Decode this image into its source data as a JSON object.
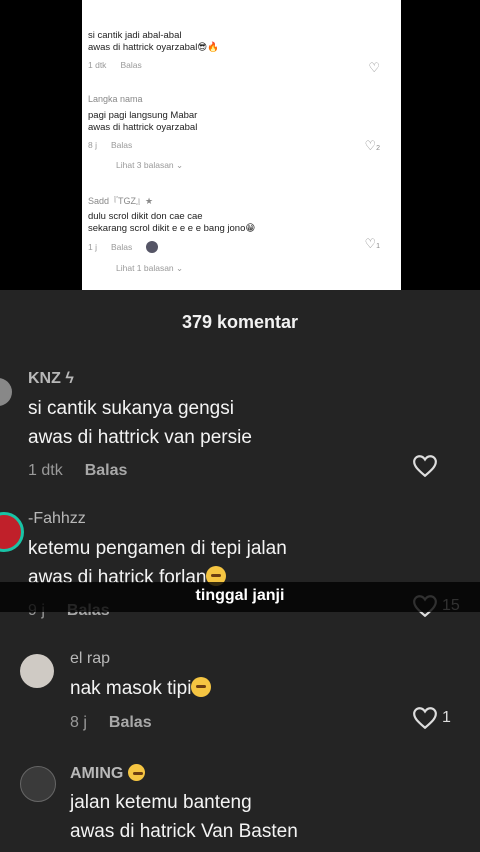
{
  "inset": {
    "comments": [
      {
        "text1": "si cantik jadi abal-abal",
        "text2": "awas di hattrick oyarzabal😎🔥",
        "time": "1 dtk",
        "reply": "Balas",
        "likes": ""
      },
      {
        "name": "Langka nama",
        "text1": "pagi pagi langsung Mabar",
        "text2": "awas di hattrick oyarzabal",
        "time": "8 j",
        "reply": "Balas",
        "likes": "2",
        "more": "Lihat 3 balasan ⌄"
      },
      {
        "name": "Sadd『TGZ』★",
        "text1": "dulu scrol dikit don cae cae",
        "text2": "sekarang scrol dikit e e e e bang jono😁",
        "time": "1 j",
        "reply": "Balas",
        "likes": "1",
        "more": "Lihat 1 balasan ⌄"
      }
    ]
  },
  "header": {
    "count": "379 komentar"
  },
  "comments": [
    {
      "user": "KNZ ϟ",
      "line1": "si cantik sukanya gengsi",
      "line2": "awas di hattrick van persie",
      "time": "1 dtk",
      "reply": "Balas",
      "likes": ""
    },
    {
      "user": "-Fahhzz",
      "line1": "ketemu pengamen di tepi jalan",
      "line2": "awas di hatrick forlan",
      "time": "9 j",
      "reply": "Balas",
      "likes": "15"
    },
    {
      "user": "el rap",
      "line1": "nak masok tipi",
      "time": "8 j",
      "reply": "Balas",
      "likes": "1"
    },
    {
      "user": "AMING",
      "line1": "jalan ketemu banteng",
      "line2": "awas di hatrick Van Basten"
    }
  ],
  "caption": "tinggal janji",
  "colors": {
    "panel": "#242424",
    "caption_bg": "#000000",
    "accent_ring": "#19c3a6"
  }
}
